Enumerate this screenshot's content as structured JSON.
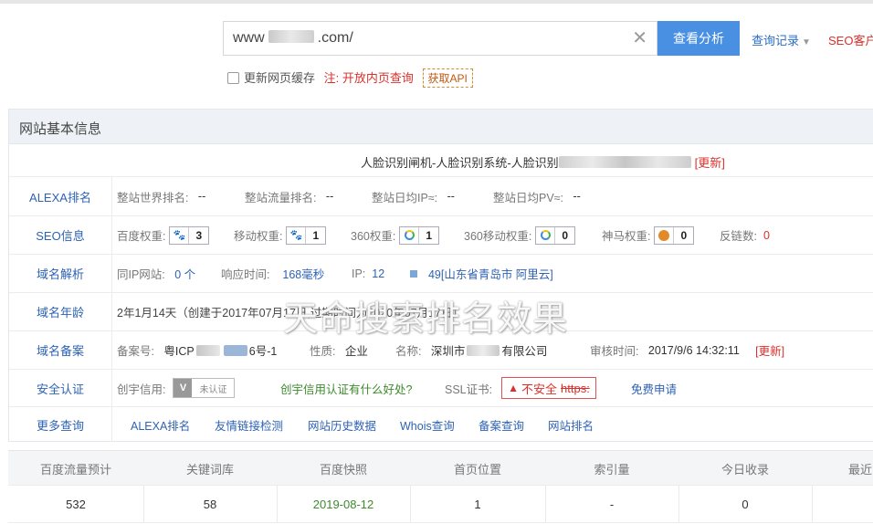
{
  "search": {
    "url_prefix": "www",
    "url_suffix": ".com/",
    "clear_icon": "close-icon",
    "button": "查看分析"
  },
  "top_links": {
    "history": "查询记录",
    "seo_client": "SEO客户"
  },
  "refresh": {
    "checkbox_label": "更新网页缓存",
    "note_prefix": "注:",
    "note_link": "开放内页查询",
    "api_button": "获取API"
  },
  "panel": {
    "title": "网站基本信息",
    "site_title": "人脸识别闸机-人脸识别系统-人脸识别",
    "site_update": "[更新]"
  },
  "rows": {
    "alexa": {
      "label": "ALEXA排名",
      "world_rank_label": "整站世界排名:",
      "world_rank": "--",
      "traffic_rank_label": "整站流量排名:",
      "traffic_rank": "--",
      "daily_ip_label": "整站日均IP≈:",
      "daily_ip": "--",
      "daily_pv_label": "整站日均PV≈:",
      "daily_pv": "--"
    },
    "seo": {
      "label": "SEO信息",
      "baidu_label": "百度权重:",
      "baidu": "3",
      "mobile_label": "移动权重:",
      "mobile": "1",
      "s360_label": "360权重:",
      "s360": "1",
      "s360m_label": "360移动权重:",
      "s360m": "0",
      "shenma_label": "神马权重:",
      "shenma": "0",
      "backlinks_label": "反链数:",
      "backlinks": "0"
    },
    "dns": {
      "label": "域名解析",
      "same_ip_label": "同IP网站:",
      "same_ip": "0 个",
      "response_label": "响应时间:",
      "response": "168毫秒",
      "ip_label": "IP:",
      "ip": "12",
      "location": "49[山东省青岛市 阿里云]"
    },
    "age": {
      "label": "域名年龄",
      "value": "2年1月14天（创建于2017年07月17日,过期时间为2020年07月17日）"
    },
    "icp": {
      "label": "域名备案",
      "icp_label": "备案号:",
      "icp_prefix": "粤ICP",
      "icp_suffix": "6号-1",
      "nature_label": "性质:",
      "nature": "企业",
      "name_label": "名称:",
      "name_prefix": "深圳市",
      "name_suffix": "有限公司",
      "audit_label": "审核时间:",
      "audit": "2017/9/6 14:32:11",
      "update": "[更新]"
    },
    "security": {
      "label": "安全认证",
      "cx_label": "创宇信用:",
      "cx_badge": "未认证",
      "cx_link": "创宇信用认证有什么好处?",
      "ssl_label": "SSL证书:",
      "ssl_badge": "不安全",
      "ssl_https": "https:",
      "free_apply": "免费申请"
    },
    "more": {
      "label": "更多查询",
      "links": [
        "ALEXA排名",
        "友情链接检测",
        "网站历史数据",
        "Whois查询",
        "备案查询",
        "网站排名"
      ]
    }
  },
  "watermark": "天命搜索排名效果",
  "stats": {
    "headers": [
      "百度流量预计",
      "关键词库",
      "百度快照",
      "首页位置",
      "索引量",
      "今日收录",
      "最近"
    ],
    "values": [
      "532",
      "58",
      "2019-08-12",
      "1",
      "-",
      "0",
      ""
    ]
  },
  "colors": {
    "primary": "#4a90e2",
    "link": "#2e62b3",
    "danger": "#d9302c",
    "green": "#3c8a2b"
  }
}
